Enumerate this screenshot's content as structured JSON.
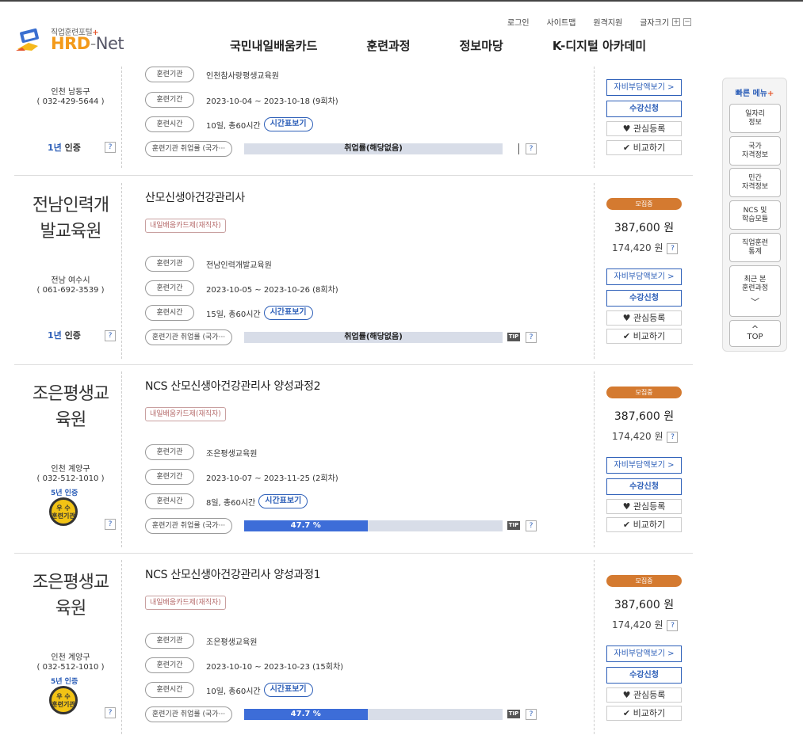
{
  "header": {
    "tagline": "직업훈련포털",
    "tagline_plus": "+",
    "brand_hrd": "HRD",
    "brand_dash": "-",
    "brand_net": "Net",
    "util": {
      "login": "로그인",
      "sitemap": "사이트맵",
      "remote": "원격지원",
      "fontsize": "글자크기",
      "plus": "+",
      "minus": "−"
    },
    "nav": [
      "국민내일배움카드",
      "훈련과정",
      "정보마당",
      "K-디지털 아카데미"
    ]
  },
  "labels": {
    "org": "훈련기관",
    "period": "훈련기간",
    "time": "훈련시간",
    "emp": "훈련기관 취업률 (국가···",
    "timetable": "시간표보기",
    "tip": "TIP",
    "q": "?",
    "self_pay": "자비부담액보기 >",
    "apply": "수강신청",
    "interest": "관심등록",
    "compare": "비교하기",
    "heart": "♥",
    "check": "✔",
    "price_unit_q": "?"
  },
  "courses": [
    {
      "loc1": "인천 남동구",
      "loc2": "( 032-429-5644 )",
      "cert_num": "1년",
      "cert_text": " 인증",
      "org": "인천참사랑평생교육원",
      "period": "2023-10-04 ~ 2023-10-18 (9회차)",
      "time": "10일, 총60시간",
      "emp": "취업률(해당없음)"
    },
    {
      "name1": "전남인력개",
      "name2": "발교육원",
      "loc1": "전남 여수시",
      "loc2": "( 061-692-3539 )",
      "cert_num": "1년",
      "cert_text": " 인증",
      "title": "산모신생아건강관리사",
      "type": "내일배움카드제(재직자)",
      "org": "전남인력개발교육원",
      "period": "2023-10-05 ~ 2023-10-26 (8회차)",
      "time": "15일, 총60시간",
      "emp": "취업률(해당없음)",
      "status": "모집중",
      "price": "387,600 원",
      "price2": "174,420 원"
    },
    {
      "name1": "조은평생교",
      "name2": "육원",
      "loc1": "인천 계양구",
      "loc2": "( 032-512-1010 )",
      "cert5": "5년 인증",
      "medal": "우 수\n훈련기관",
      "title": "NCS 산모신생아건강관리사 양성과정2",
      "type": "내일배움카드제(재직자)",
      "org": "조은평생교육원",
      "period": "2023-10-07 ~ 2023-11-25 (2회차)",
      "time": "8일, 총60시간",
      "emp": "47.7 %",
      "emp_rate": 47.7,
      "status": "모집중",
      "price": "387,600 원",
      "price2": "174,420 원"
    },
    {
      "name1": "조은평생교",
      "name2": "육원",
      "loc1": "인천 계양구",
      "loc2": "( 032-512-1010 )",
      "cert5": "5년 인증",
      "medal": "우 수\n훈련기관",
      "title": "NCS 산모신생아건강관리사 양성과정1",
      "type": "내일배움카드제(재직자)",
      "org": "조은평생교육원",
      "period": "2023-10-10 ~ 2023-10-23 (15회차)",
      "time": "10일, 총60시간",
      "emp": "47.7 %",
      "emp_rate": 47.7,
      "status": "모집중",
      "price": "387,600 원",
      "price2": "174,420 원"
    }
  ],
  "quick": {
    "title": "빠른 메뉴",
    "title_plus": "+",
    "items": [
      "일자리\n정보",
      "국가\n자격정보",
      "민간\n자격정보",
      "NCS 및\n학습모듈",
      "직업훈련\n통계",
      "최근 본\n훈련과정"
    ],
    "chevron": "﹀",
    "top_arrow": "^",
    "top": "TOP"
  }
}
